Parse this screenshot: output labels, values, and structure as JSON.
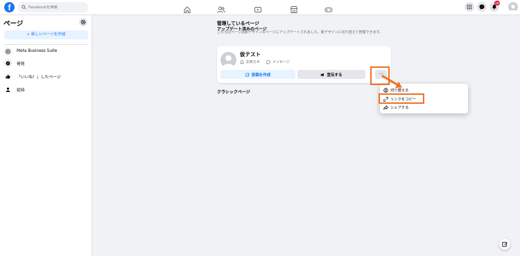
{
  "header": {
    "logo_letter": "f",
    "search_placeholder": "Facebookを検索",
    "notification_count": "16"
  },
  "sidebar": {
    "title": "ページ",
    "create_button": "+ 新しいページを作成",
    "items": [
      {
        "label": "Meta Business Suite"
      },
      {
        "label": "発見"
      },
      {
        "label": "「いいね！」したページ"
      },
      {
        "label": "招待"
      }
    ]
  },
  "main": {
    "title": "管理しているページ",
    "section_title": "アップデート済みのページ",
    "section_desc": "これらのページは新デザインのページにアップデートされました。新デザインに切り替えて管理できます。",
    "card": {
      "name": "仮テスト",
      "notifications": "お知らせ",
      "messages": "メッセージ",
      "create_post": "投稿を作成",
      "promote": "宣伝する",
      "more": "···"
    },
    "classic_title": "クラシックページ"
  },
  "dropdown": {
    "items": [
      {
        "label": "切り替える"
      },
      {
        "label": "リンクをコピー"
      },
      {
        "label": "シェアする"
      }
    ]
  },
  "colors": {
    "accent": "#1877f2",
    "highlight": "#f26f21"
  }
}
